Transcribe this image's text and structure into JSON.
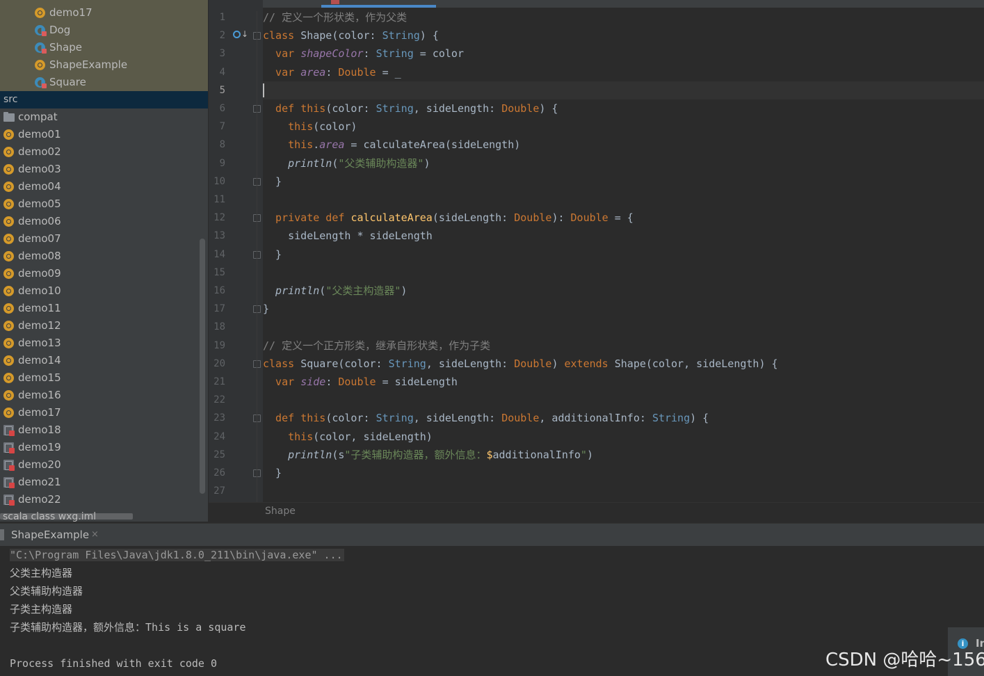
{
  "project_tree": {
    "top_items": [
      {
        "label": "demo17",
        "icon": "object-icon"
      },
      {
        "label": "Dog",
        "icon": "class-icon"
      },
      {
        "label": "Shape",
        "icon": "class-icon"
      },
      {
        "label": "ShapeExample",
        "icon": "object-icon"
      },
      {
        "label": "Square",
        "icon": "class-icon"
      }
    ],
    "src_label": "src",
    "items": [
      {
        "label": "compat",
        "icon": "folder-icon"
      },
      {
        "label": "demo01",
        "icon": "object-icon"
      },
      {
        "label": "demo02",
        "icon": "object-icon"
      },
      {
        "label": "demo03",
        "icon": "object-icon"
      },
      {
        "label": "demo04",
        "icon": "object-icon"
      },
      {
        "label": "demo05",
        "icon": "object-icon"
      },
      {
        "label": "demo06",
        "icon": "object-icon"
      },
      {
        "label": "demo07",
        "icon": "object-icon"
      },
      {
        "label": "demo08",
        "icon": "object-icon"
      },
      {
        "label": "demo09",
        "icon": "object-icon"
      },
      {
        "label": "demo10",
        "icon": "object-icon"
      },
      {
        "label": "demo11",
        "icon": "object-icon"
      },
      {
        "label": "demo12",
        "icon": "object-icon"
      },
      {
        "label": "demo13",
        "icon": "object-icon"
      },
      {
        "label": "demo14",
        "icon": "object-icon"
      },
      {
        "label": "demo15",
        "icon": "object-icon"
      },
      {
        "label": "demo16",
        "icon": "object-icon"
      },
      {
        "label": "demo17",
        "icon": "object-icon"
      },
      {
        "label": "demo18",
        "icon": "scala-file-icon"
      },
      {
        "label": "demo19",
        "icon": "scala-file-icon"
      },
      {
        "label": "demo20",
        "icon": "scala-file-icon"
      },
      {
        "label": "demo21",
        "icon": "scala-file-icon"
      },
      {
        "label": "demo22",
        "icon": "scala-file-icon"
      }
    ],
    "iml_label": "scala class wxg.iml"
  },
  "editor": {
    "breadcrumb": "Shape",
    "current_line": 5,
    "lines": [
      [
        [
          "// 定义一个形状类，作为父类",
          "cm"
        ]
      ],
      [
        [
          "class ",
          "kw"
        ],
        [
          "Shape(color: ",
          ""
        ],
        [
          "String",
          "ty"
        ],
        [
          ") {",
          ""
        ]
      ],
      [
        [
          "  var ",
          "kw"
        ],
        [
          "shapeColor",
          "pv"
        ],
        [
          ": ",
          ""
        ],
        [
          "String",
          "ty"
        ],
        [
          " = color",
          ""
        ]
      ],
      [
        [
          "  var ",
          "kw"
        ],
        [
          "area",
          "pv"
        ],
        [
          ": ",
          ""
        ],
        [
          "Double",
          "kw"
        ],
        [
          " = _",
          ""
        ]
      ],
      [
        [
          "",
          ""
        ]
      ],
      [
        [
          "  def ",
          "kw"
        ],
        [
          "this",
          "kw"
        ],
        [
          "(color: ",
          ""
        ],
        [
          "String",
          "ty"
        ],
        [
          ", sideLength: ",
          ""
        ],
        [
          "Double",
          "kw"
        ],
        [
          ") {",
          ""
        ]
      ],
      [
        [
          "    this",
          "kw"
        ],
        [
          "(color)",
          ""
        ]
      ],
      [
        [
          "    this",
          "kw"
        ],
        [
          ".",
          ""
        ],
        [
          "area",
          "pv"
        ],
        [
          " = calculateArea(sideLength)",
          ""
        ]
      ],
      [
        [
          "    println",
          "it"
        ],
        [
          "(",
          ""
        ],
        [
          "\"父类辅助构造器\"",
          "st"
        ],
        [
          ")",
          ""
        ]
      ],
      [
        [
          "  }",
          ""
        ]
      ],
      [
        [
          "",
          ""
        ]
      ],
      [
        [
          "  private def ",
          "kw"
        ],
        [
          "calculateArea",
          "fn"
        ],
        [
          "(sideLength: ",
          ""
        ],
        [
          "Double",
          "kw"
        ],
        [
          "): ",
          ""
        ],
        [
          "Double",
          "kw"
        ],
        [
          " = {",
          ""
        ]
      ],
      [
        [
          "    sideLength * sideLength",
          ""
        ]
      ],
      [
        [
          "  }",
          ""
        ]
      ],
      [
        [
          "",
          ""
        ]
      ],
      [
        [
          "  println",
          "it"
        ],
        [
          "(",
          ""
        ],
        [
          "\"父类主构造器\"",
          "st"
        ],
        [
          ")",
          ""
        ]
      ],
      [
        [
          "}",
          ""
        ]
      ],
      [
        [
          "",
          ""
        ]
      ],
      [
        [
          "// 定义一个正方形类，继承自形状类，作为子类",
          "cm"
        ]
      ],
      [
        [
          "class ",
          "kw"
        ],
        [
          "Square(color: ",
          ""
        ],
        [
          "String",
          "ty"
        ],
        [
          ", sideLength: ",
          ""
        ],
        [
          "Double",
          "kw"
        ],
        [
          ") ",
          ""
        ],
        [
          "extends ",
          "kw"
        ],
        [
          "Shape(color, sideLength) {",
          ""
        ]
      ],
      [
        [
          "  var ",
          "kw"
        ],
        [
          "side",
          "pv"
        ],
        [
          ": ",
          ""
        ],
        [
          "Double",
          "kw"
        ],
        [
          " = sideLength",
          ""
        ]
      ],
      [
        [
          "",
          ""
        ]
      ],
      [
        [
          "  def ",
          "kw"
        ],
        [
          "this",
          "kw"
        ],
        [
          "(color: ",
          ""
        ],
        [
          "String",
          "ty"
        ],
        [
          ", sideLength: ",
          ""
        ],
        [
          "Double",
          "kw"
        ],
        [
          ", additionalInfo: ",
          ""
        ],
        [
          "String",
          "ty"
        ],
        [
          ") {",
          ""
        ]
      ],
      [
        [
          "    this",
          "kw"
        ],
        [
          "(color, sideLength)",
          ""
        ]
      ],
      [
        [
          "    println",
          "it"
        ],
        [
          "(s",
          ""
        ],
        [
          "\"子类辅助构造器，额外信息：",
          "st"
        ],
        [
          "$",
          "dl"
        ],
        [
          "additionalInfo",
          ""
        ],
        [
          "\"",
          "st"
        ],
        [
          ")",
          ""
        ]
      ],
      [
        [
          "  }",
          ""
        ]
      ],
      [
        [
          "",
          ""
        ]
      ]
    ]
  },
  "run_panel": {
    "tab_label": "ShapeExample",
    "close_glyph": "×",
    "output": [
      "\"C:\\Program Files\\Java\\jdk1.8.0_211\\bin\\java.exe\" ...",
      "父类主构造器",
      "父类辅助构造器",
      "子类主构造器",
      "子类辅助构造器，额外信息：This is a square",
      "",
      "Process finished with exit code 0"
    ]
  },
  "notification": {
    "text": "In",
    "icon": "info-icon"
  },
  "watermark": "CSDN @哈哈~156"
}
